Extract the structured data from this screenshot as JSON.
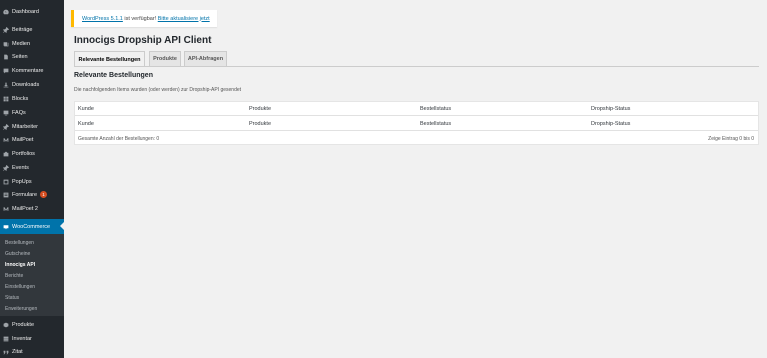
{
  "sidebar": {
    "menu": [
      {
        "label": "Dashboard",
        "icon": "dashboard-icon"
      },
      {
        "label": "Beiträge",
        "icon": "pin-icon"
      },
      {
        "label": "Medien",
        "icon": "media-icon"
      },
      {
        "label": "Seiten",
        "icon": "page-icon"
      },
      {
        "label": "Kommentare",
        "icon": "comment-icon"
      },
      {
        "label": "Downloads",
        "icon": "download-icon"
      },
      {
        "label": "Blocks",
        "icon": "blocks-icon"
      },
      {
        "label": "FAQs",
        "icon": "faq-icon"
      },
      {
        "label": "Mitarbeiter",
        "icon": "staff-icon"
      },
      {
        "label": "MailPoet",
        "icon": "mailpoet-icon"
      },
      {
        "label": "Portfolios",
        "icon": "portfolio-icon"
      },
      {
        "label": "Events",
        "icon": "pin-icon"
      },
      {
        "label": "PopUps",
        "icon": "popup-icon"
      },
      {
        "label": "Formulare",
        "icon": "forms-icon",
        "badge": "1"
      },
      {
        "label": "MailPoet 2",
        "icon": "mailpoet-icon"
      },
      {
        "label": "WooCommerce",
        "icon": "woocommerce-icon",
        "active": true
      }
    ],
    "submenu": [
      "Bestellungen",
      "Gutscheine",
      "Innocigs API",
      "Berichte",
      "Einstellungen",
      "Status",
      "Erweiterungen"
    ],
    "bottom_menu": [
      {
        "label": "Produkte",
        "icon": "products-icon"
      },
      {
        "label": "Inventar",
        "icon": "inventory-icon"
      },
      {
        "label": "Zitat",
        "icon": "quote-icon"
      }
    ]
  },
  "notice": {
    "version_link": "WordPress 5.1.1",
    "text": " ist verfügbar! ",
    "update_link": "Bitte aktualisiere jetzt"
  },
  "page": {
    "title": "Innocigs Dropship API Client",
    "tabs": [
      "Relevante Bestellungen",
      "Produkte",
      "API-Abfragen"
    ],
    "section_title": "Relevante Bestellungen",
    "section_desc": "Die nachfolgenden Items wurden (oder werden) zur Dropship-API gesendet"
  },
  "table": {
    "columns": [
      "Kunde",
      "Produkte",
      "Bestellstatus",
      "Dropship-Status"
    ],
    "footer_left": "Gesamte Anzahl der Bestellungen: 0",
    "footer_right": "Zeige Eintrag 0 bis 0"
  },
  "colors": {
    "sidebar_bg": "#23282d",
    "active_bg": "#0073aa",
    "notice_border": "#ffb900",
    "badge": "#d54e21"
  }
}
